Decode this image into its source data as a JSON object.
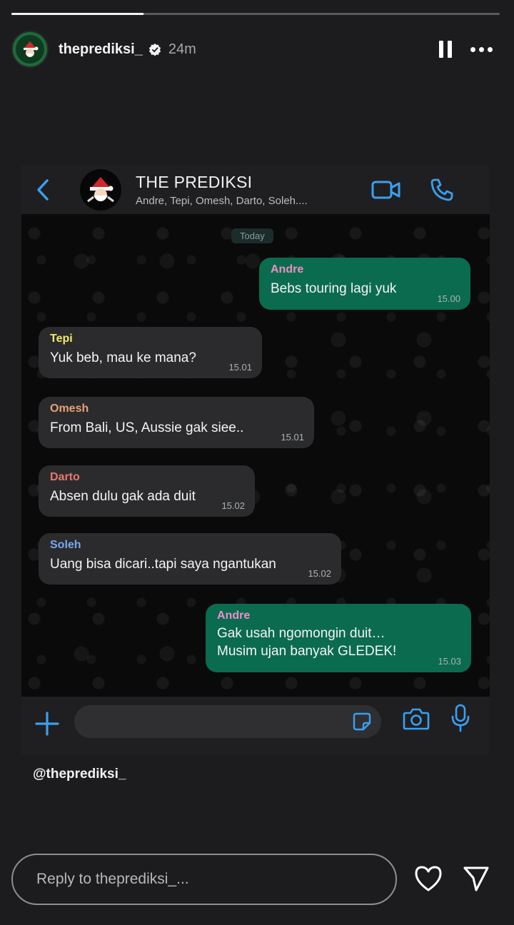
{
  "story": {
    "username": "theprediksi_",
    "time": "24m",
    "progress": 0.27,
    "caption": "@theprediksi_",
    "reply_placeholder": "Reply to theprediksi_..."
  },
  "chat": {
    "group_name": "THE PREDIKSI",
    "members": "Andre, Tepi, Omesh, Darto, Soleh....",
    "date_chip": "Today",
    "messages": [
      {
        "sender": "Andre",
        "text": "Bebs touring lagi yuk",
        "time": "15.00",
        "direction": "out",
        "sender_color": "#f08cc6"
      },
      {
        "sender": "Tepi",
        "text": "Yuk beb, mau ke mana?",
        "time": "15.01",
        "direction": "in",
        "sender_color": "#f0ea6a"
      },
      {
        "sender": "Omesh",
        "text": "From Bali, US, Aussie gak siee..",
        "time": "15.01",
        "direction": "in",
        "sender_color": "#e8a07a"
      },
      {
        "sender": "Darto",
        "text": "Absen dulu gak ada duit",
        "time": "15.02",
        "direction": "in",
        "sender_color": "#e67a6a"
      },
      {
        "sender": "Soleh",
        "text": "Uang bisa dicari..tapi saya ngantukan",
        "time": "15.02",
        "direction": "in",
        "sender_color": "#7aa8f0"
      },
      {
        "sender": "Andre",
        "text": "Gak usah ngomongin duit…\nMusim ujan banyak GLEDEK!",
        "time": "15.03",
        "direction": "out",
        "sender_color": "#f08cc6"
      }
    ]
  },
  "colors": {
    "outgoing_bubble": "#0b6b4f",
    "incoming_bubble": "#2b2b2d",
    "accent_blue": "#3aa0f0"
  },
  "icons": {
    "back": "chevron-left-icon",
    "video": "video-camera-icon",
    "call": "phone-icon",
    "plus": "plus-icon",
    "sticker": "sticker-icon",
    "camera": "camera-icon",
    "mic": "microphone-icon",
    "heart": "heart-icon",
    "send": "paper-plane-icon",
    "pause": "pause-icon",
    "more": "more-dots-icon",
    "verified": "verified-badge-icon"
  }
}
